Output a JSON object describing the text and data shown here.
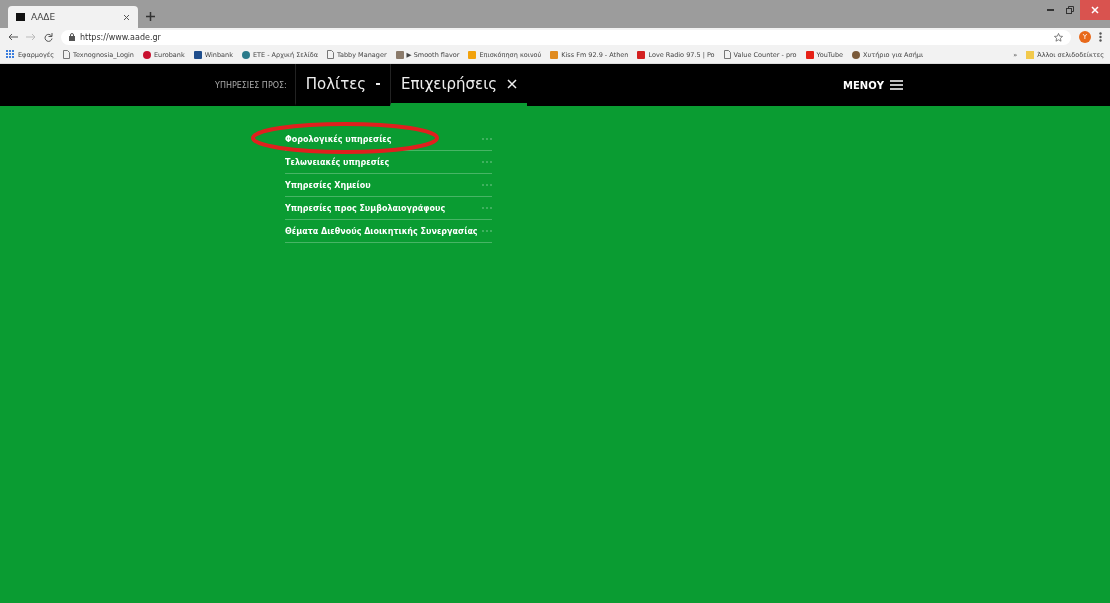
{
  "browser": {
    "tab_title": "ΑΑΔΕ",
    "url": "https://www.aade.gr",
    "profile_initial": "Y",
    "bookmarks": [
      {
        "label": "Εφαρμογές",
        "kind": "apps",
        "color": "#3b7ddd"
      },
      {
        "label": "Texnognosia_Login",
        "kind": "page",
        "color": "#777777"
      },
      {
        "label": "Eurobank",
        "kind": "dot",
        "color": "#c8102e"
      },
      {
        "label": "Winbank",
        "kind": "square",
        "color": "#1f4e8c"
      },
      {
        "label": "ETE - Αρχική Σελίδα",
        "kind": "dot",
        "color": "#2b7a8a"
      },
      {
        "label": "Tabby Manager",
        "kind": "page",
        "color": "#777777"
      },
      {
        "label": "▶ Smooth flavor",
        "kind": "square",
        "color": "#8a7a6a"
      },
      {
        "label": "Επισκόπηση κοινού",
        "kind": "square",
        "color": "#f2a20c"
      },
      {
        "label": "Kiss Fm 92.9 - Athen",
        "kind": "square",
        "color": "#e08a1e"
      },
      {
        "label": "Love Radio 97.5 | Po",
        "kind": "square",
        "color": "#d32020"
      },
      {
        "label": "Value Counter - pro",
        "kind": "page",
        "color": "#777777"
      },
      {
        "label": "YouTube",
        "kind": "square",
        "color": "#e62117"
      },
      {
        "label": "Χυτήριο για Ασήμι",
        "kind": "dot",
        "color": "#7a5a3a"
      }
    ],
    "more": "»",
    "other_bookmarks": "Άλλοι σελιδοδείκτες"
  },
  "nav": {
    "prefix": "ΥΠΗΡΕΣΙΕΣ ΠΡΟΣ:",
    "tabs": [
      {
        "label": "Πολίτες",
        "selected": false
      },
      {
        "label": "Επιχειρήσεις",
        "selected": true
      }
    ],
    "menu": "ΜΕΝΟΥ"
  },
  "submenu": [
    {
      "label": "Φορολογικές υπηρεσίες",
      "highlighted": true
    },
    {
      "label": "Τελωνειακές υπηρεσίες",
      "highlighted": false
    },
    {
      "label": "Υπηρεσίες Χημείου",
      "highlighted": false
    },
    {
      "label": "Υπηρεσίες προς Συμβολαιογράφους",
      "highlighted": false
    },
    {
      "label": "Θέματα Διεθνούς Διοικητικής Συνεργασίας",
      "highlighted": false
    }
  ]
}
